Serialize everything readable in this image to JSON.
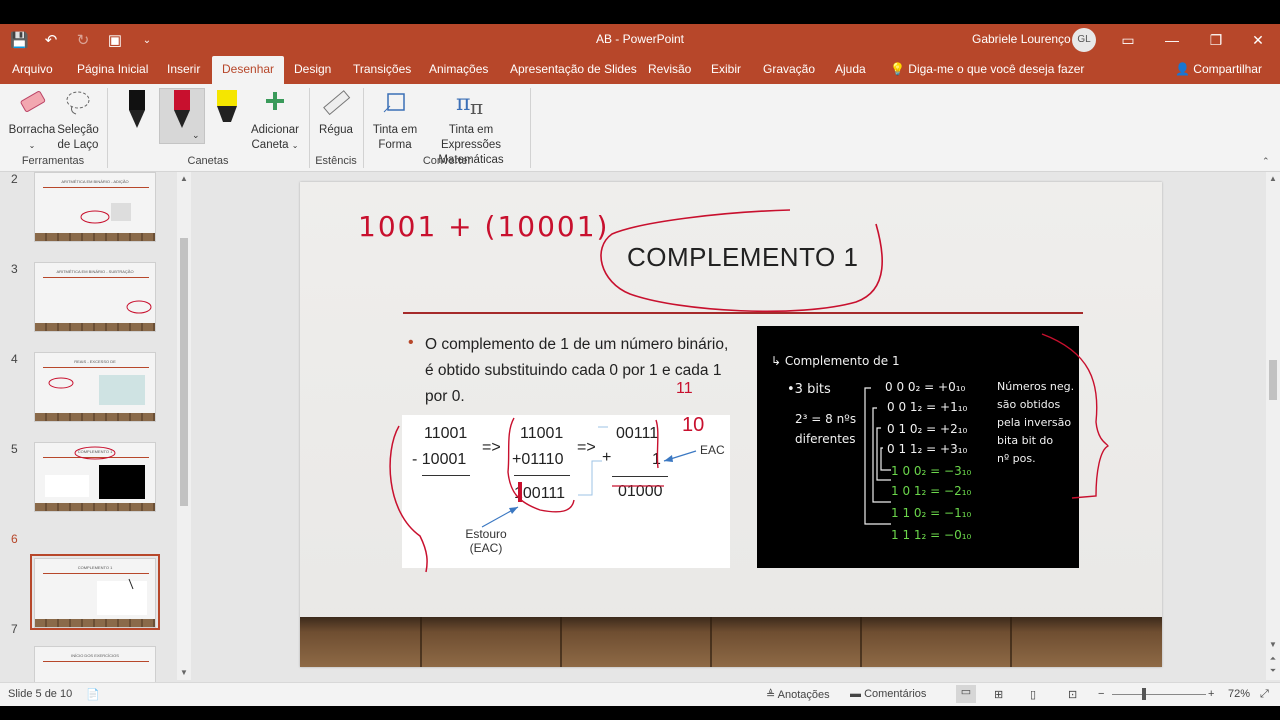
{
  "titlebar": {
    "doc_title": "AB  -  PowerPoint",
    "user_name": "Gabriele Lourenço",
    "user_initials": "GL"
  },
  "tabs": [
    "Arquivo",
    "Página Inicial",
    "Inserir",
    "Desenhar",
    "Design",
    "Transições",
    "Animações",
    "Apresentação de Slides",
    "Revisão",
    "Exibir",
    "Gravação",
    "Ajuda"
  ],
  "active_tab": "Desenhar",
  "tell_me": "Diga-me o que você deseja fazer",
  "share_label": "Compartilhar",
  "ribbon": {
    "eraser": "Borracha",
    "lasso_1": "Seleção",
    "lasso_2": "de Laço",
    "group_tools": "Ferramentas",
    "add_pen_1": "Adicionar",
    "add_pen_2": "Caneta",
    "group_pens": "Canetas",
    "ruler": "Régua",
    "group_stencils": "Estêncis",
    "ink_to_shape_1": "Tinta em",
    "ink_to_shape_2": "Forma",
    "ink_to_math_1": "Tinta em Expressões",
    "ink_to_math_2": "Matemáticas",
    "group_convert": "Converter",
    "pen_colors": [
      "#111111",
      "#c8102e",
      "#f5e600"
    ]
  },
  "thumbnails": {
    "numbers": [
      "2",
      "3",
      "4",
      "5",
      "6",
      "7"
    ],
    "titles": [
      "ARITMÉTICA EM BINÁRIO - ADIÇÃO",
      "ARITMÉTICA EM BINÁRIO - SUBTRAÇÃO",
      "REAIS - EXCESSO DE",
      "COMPLEMENTO 1",
      "COMPLEMENTO 1",
      "INÍCIO DOS EXERCÍCIOS"
    ],
    "active_index": 4
  },
  "slide": {
    "title": "COMPLEMENTO 1",
    "bullet": "O complemento de 1 de um número binário, é obtido substituindo cada 0 por 1 e cada 1 por 0.",
    "handwritten_top": "1001 + (10001)",
    "calc": {
      "a1": "11001",
      "a2": "- 10001",
      "arrow1": "=>",
      "b1": "11001",
      "b2": "+01110",
      "b3": "100111",
      "arrow2": "=>",
      "c1": "00111",
      "c_plus": "+",
      "c2": "1",
      "c3": "01000",
      "eac": "EAC",
      "estouro_1": "Estouro",
      "estouro_2": "(EAC)",
      "ink_11": "11",
      "ink_10": "10"
    },
    "blackboard": {
      "heading": "↳ Complemento de 1",
      "bits": "•3 bits",
      "formula": "2³ = 8 nºs",
      "formula2": "diferentes",
      "rows": [
        "0 0 0₂ = +0₁₀",
        "0 0 1₂ = +1₁₀",
        "0 1 0₂ = +2₁₀",
        "0 1 1₂ = +3₁₀",
        "1 0 0₂ = −3₁₀",
        "1 0 1₂ = −2₁₀",
        "1 1 0₂ = −1₁₀",
        "1 1 1₂ = −0₁₀"
      ],
      "note": [
        "Números neg.",
        "são obtidos",
        "pela inversão",
        "bita bit do",
        "nº pos."
      ]
    }
  },
  "statusbar": {
    "slide_info": "Slide 5 de 10",
    "notes": "Anotações",
    "comments": "Comentários",
    "zoom": "72%"
  },
  "colors": {
    "accent": "#b7472a",
    "ink_red": "#c8102e",
    "board_green": "#6bd64b"
  }
}
